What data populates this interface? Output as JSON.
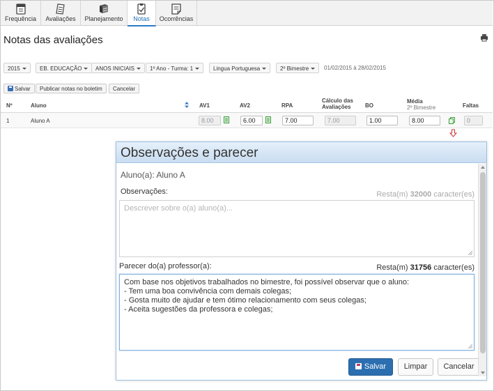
{
  "nav": {
    "tabs": [
      {
        "label": "Frequência",
        "icon": "calendar-icon"
      },
      {
        "label": "Avaliações",
        "icon": "notepad-icon"
      },
      {
        "label": "Planejamento",
        "icon": "books-icon"
      },
      {
        "label": "Notas",
        "icon": "clipboard-check-icon",
        "active": true
      },
      {
        "label": "Ocorrências",
        "icon": "note-lines-icon"
      }
    ]
  },
  "page": {
    "title": "Notas das avaliações"
  },
  "filters": {
    "year": "2015",
    "segment": "EB. EDUCAÇÃO",
    "level": "ANOS INICIAIS",
    "class": "1º Ano - Turma: 1",
    "subject": "Lingua Portuguesa",
    "period": "2º Bimestre",
    "date_range": "01/02/2015 à 28/02/2015"
  },
  "actions": {
    "save": "Salvar",
    "publish": "Publicar notas no boletim",
    "cancel": "Cancelar"
  },
  "table": {
    "headers": {
      "num": "Nº",
      "student": "Aluno",
      "av1": "AV1",
      "av2": "AV2",
      "rpa": "RPA",
      "calc_line1": "Cálculo das",
      "calc_line2": "Avaliações",
      "bo": "BO",
      "avg": "Média",
      "avg_sub": "2º Bimestre",
      "absences": "Faltas"
    },
    "rows": [
      {
        "num": "1",
        "student": "Aluno A",
        "av1": "8.00",
        "av2": "6.00",
        "rpa": "7.00",
        "calc": "7.00",
        "bo": "1.00",
        "avg": "8.00",
        "absences": "0"
      }
    ]
  },
  "modal": {
    "title": "Observações e parecer",
    "student_label": "Aluno(a):",
    "student_name": "Aluno A",
    "obs_label": "Observações:",
    "obs_counter_prefix": "Resta(m)",
    "obs_counter_value": "32000",
    "obs_counter_suffix": "caracter(es)",
    "obs_placeholder": "Descrever sobre o(a) aluno(a)...",
    "opinion_label": "Parecer do(a) professor(a):",
    "opinion_counter_prefix": "Resta(m)",
    "opinion_counter_value": "31756",
    "opinion_counter_suffix": "caracter(es)",
    "opinion_lines": [
      "Com base nos objetivos trabalhados no bimestre, foi possível observar que o aluno:",
      "- Tem uma boa convivência com demais colegas;",
      "- Gosta muito de ajudar e tem ótimo relacionamento com seus colegas;",
      "- Aceita sugestões da professora e colegas;"
    ],
    "buttons": {
      "save": "Salvar",
      "clear": "Limpar",
      "cancel": "Cancelar"
    }
  },
  "colors": {
    "accent": "#2b7cc6",
    "primary_button": "#2c6fb0",
    "modal_header": "#c9ddf1",
    "icon_green": "#3a9a3a",
    "arrow_red": "#cc3333"
  }
}
